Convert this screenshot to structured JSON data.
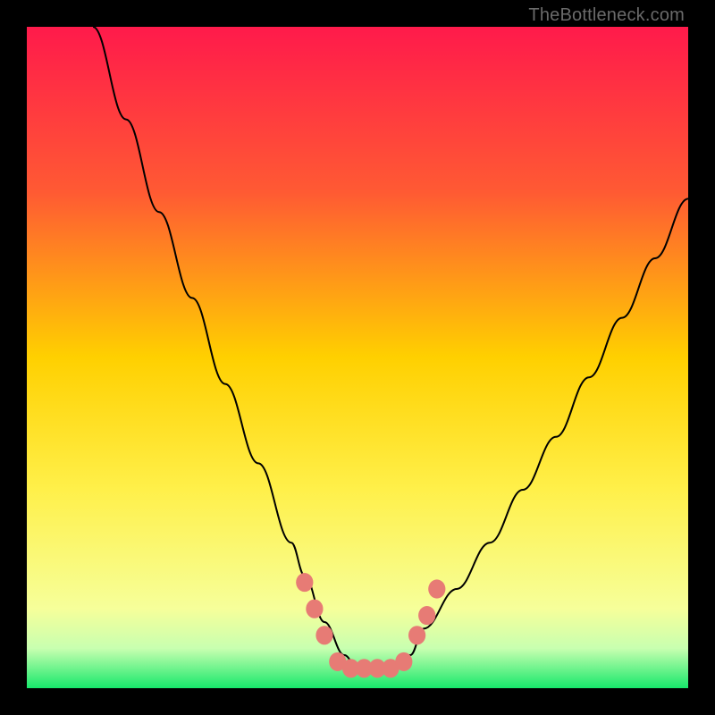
{
  "attribution": "TheBottleneck.com",
  "chart_data": {
    "type": "line",
    "title": "",
    "xlabel": "",
    "ylabel": "",
    "xlim": [
      0,
      100
    ],
    "ylim": [
      0,
      100
    ],
    "gradient_stops": [
      {
        "offset": 0,
        "color": "#ff1a4b"
      },
      {
        "offset": 25,
        "color": "#ff5a33"
      },
      {
        "offset": 50,
        "color": "#ffd000"
      },
      {
        "offset": 70,
        "color": "#fff04a"
      },
      {
        "offset": 88,
        "color": "#f6ff9a"
      },
      {
        "offset": 94,
        "color": "#c8ffb0"
      },
      {
        "offset": 100,
        "color": "#17e86b"
      }
    ],
    "series": [
      {
        "name": "bottleneck-curve",
        "x": [
          10,
          15,
          20,
          25,
          30,
          35,
          40,
          42,
          45,
          48,
          50,
          52,
          55,
          58,
          60,
          65,
          70,
          75,
          80,
          85,
          90,
          95,
          100
        ],
        "y": [
          100,
          86,
          72,
          59,
          46,
          34,
          22,
          17,
          10,
          5,
          3,
          3,
          3,
          5,
          9,
          15,
          22,
          30,
          38,
          47,
          56,
          65,
          74
        ]
      }
    ],
    "markers": {
      "name": "highlight-dots",
      "color": "#e77b75",
      "radius_pct": 1.3,
      "points": [
        {
          "x": 42.0,
          "y": 16
        },
        {
          "x": 43.5,
          "y": 12
        },
        {
          "x": 45.0,
          "y": 8
        },
        {
          "x": 47.0,
          "y": 4
        },
        {
          "x": 49.0,
          "y": 3
        },
        {
          "x": 51.0,
          "y": 3
        },
        {
          "x": 53.0,
          "y": 3
        },
        {
          "x": 55.0,
          "y": 3
        },
        {
          "x": 57.0,
          "y": 4
        },
        {
          "x": 59.0,
          "y": 8
        },
        {
          "x": 60.5,
          "y": 11
        },
        {
          "x": 62.0,
          "y": 15
        }
      ]
    }
  }
}
